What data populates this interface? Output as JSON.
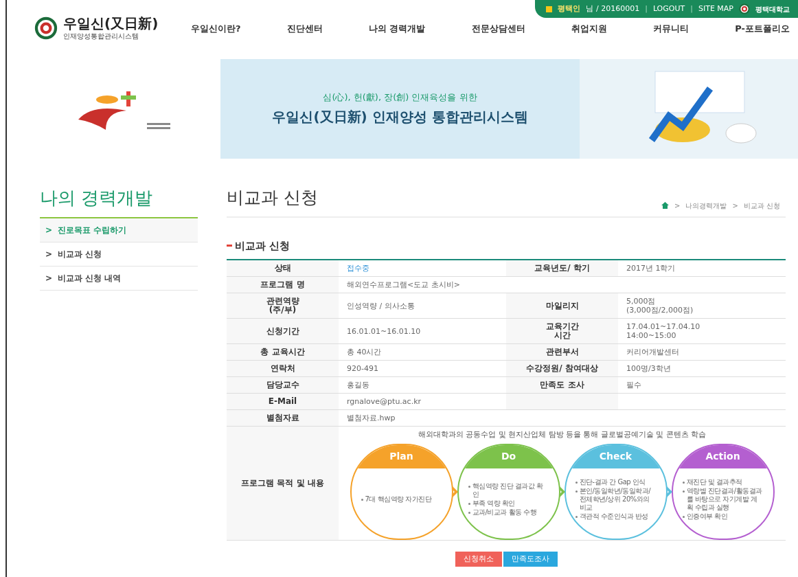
{
  "brand": {
    "name": "우일신(又日新)",
    "subtitle": "인재양성통합관리시스템"
  },
  "user_bar": {
    "user": "평택인",
    "user_suffix": "님 / 20160001",
    "links": [
      "LOGOUT",
      "SITE MAP"
    ],
    "separator": "|",
    "university": "평택대학교"
  },
  "nav": [
    "우일신이란?",
    "진단센터",
    "나의 경력개발",
    "전문상담센터",
    "취업지원",
    "커뮤니티",
    "P-포트폴리오"
  ],
  "banner": {
    "tagline": "심(心), 헌(獻), 장(創) 인재육성을 위한",
    "headline": "우일신(又日新) 인재양성 통합관리시스템"
  },
  "sidebar": {
    "title": "나의 경력개발",
    "marker": ">",
    "items": [
      {
        "label": "진로목표 수립하기",
        "selected": true
      },
      {
        "label": "비교과 신청",
        "selected": false
      },
      {
        "label": "비교과 신청 내역",
        "selected": false
      }
    ]
  },
  "page_title": "비교과 신청",
  "breadcrumb": {
    "separator": ">",
    "items": [
      "나의경력개발",
      "비교과 신청"
    ]
  },
  "section_title": "비교과 신청",
  "table": {
    "rows": [
      {
        "kind": "pair",
        "cells": [
          {
            "label": "상태",
            "value": "접수중",
            "emphasis": true
          },
          {
            "label": "교육년도/ 학기",
            "value": "2017년 1학기"
          }
        ]
      },
      {
        "kind": "full",
        "cells": [
          {
            "label": "프로그램 명",
            "value": "해외연수프로그램<도교 초시비>"
          }
        ]
      },
      {
        "kind": "pair",
        "cells": [
          {
            "label": "관련역량\n(주/부)",
            "value": "인성역량 / 의사소통"
          },
          {
            "label": "마일리지",
            "value": "5,000점\n(3,000점/2,000점)"
          }
        ]
      },
      {
        "kind": "pair",
        "cells": [
          {
            "label": "신청기간",
            "value": "16.01.01~16.01.10"
          },
          {
            "label": "교육기간\n시간",
            "value": "17.04.01~17.04.10\n14:00~15:00"
          }
        ]
      },
      {
        "kind": "pair",
        "cells": [
          {
            "label": "총 교육시간",
            "value": "총 40시간"
          },
          {
            "label": "관련부서",
            "value": "커리어개발센터"
          }
        ]
      },
      {
        "kind": "pair",
        "cells": [
          {
            "label": "연락처",
            "value": "920-491"
          },
          {
            "label": "수강정원/ 참여대상",
            "value": "100명/3학년"
          }
        ]
      },
      {
        "kind": "pair",
        "cells": [
          {
            "label": "담당교수",
            "value": "홍길동"
          },
          {
            "label": "만족도 조사",
            "value": "필수"
          }
        ]
      },
      {
        "kind": "half",
        "cells": [
          {
            "label": "E-Mail",
            "value": "rgnalove@ptu.ac.kr"
          }
        ]
      },
      {
        "kind": "full",
        "cells": [
          {
            "label": "별첨자료",
            "value": "별첨자료.hwp"
          }
        ]
      },
      {
        "kind": "pdca",
        "cells": [
          {
            "label": "프로그램 목적 및 내용",
            "value": "해외대학과의 공동수업 및 현지산업체 탐방 등을 통해 글로벌공예기술 및 콘텐츠 학습"
          }
        ]
      }
    ]
  },
  "pdca": [
    {
      "title": "Plan",
      "color": "#f5a22a",
      "items": [
        "7대 핵심역량 자가진단"
      ]
    },
    {
      "title": "Do",
      "color": "#7dc24b",
      "items": [
        "핵심역량 진단 결과값 확인",
        "부족 역량 확인",
        "교과/비교과 활동 수행"
      ]
    },
    {
      "title": "Check",
      "color": "#5bc0de",
      "items": [
        "진단-결과 간 Gap 인식",
        "본인/동일학년/동일학과/전체학년/상위 20%와의 비교",
        "객관적 수준인식과 반성"
      ]
    },
    {
      "title": "Action",
      "color": "#b45fd0",
      "items": [
        "재진단 및 결과추적",
        "역량별 진단결과/활동결과를 바탕으로 자기계발 계획 수립과 실행",
        "인증여부 확인"
      ]
    }
  ],
  "buttons": [
    {
      "label": "신청취소",
      "color": "#f0625a"
    },
    {
      "label": "만족도조사",
      "color": "#2aa7de"
    }
  ]
}
